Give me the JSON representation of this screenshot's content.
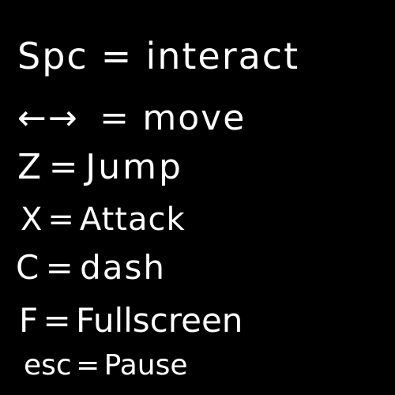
{
  "controls": [
    {
      "key": "Spc",
      "separator": "=",
      "action": "interact"
    },
    {
      "key": "←→",
      "separator": "=",
      "action": "move"
    },
    {
      "key": "Z",
      "separator": "=",
      "action": "Jump"
    },
    {
      "key": "X",
      "separator": "=",
      "action": "Attack"
    },
    {
      "key": "C",
      "separator": "=",
      "action": "dash"
    },
    {
      "key": "F",
      "separator": "=",
      "action": "Fullscreen"
    },
    {
      "key": "esc",
      "separator": "=",
      "action": "Pause"
    }
  ],
  "colors": {
    "background": "#000000",
    "text": "#ffffff"
  }
}
